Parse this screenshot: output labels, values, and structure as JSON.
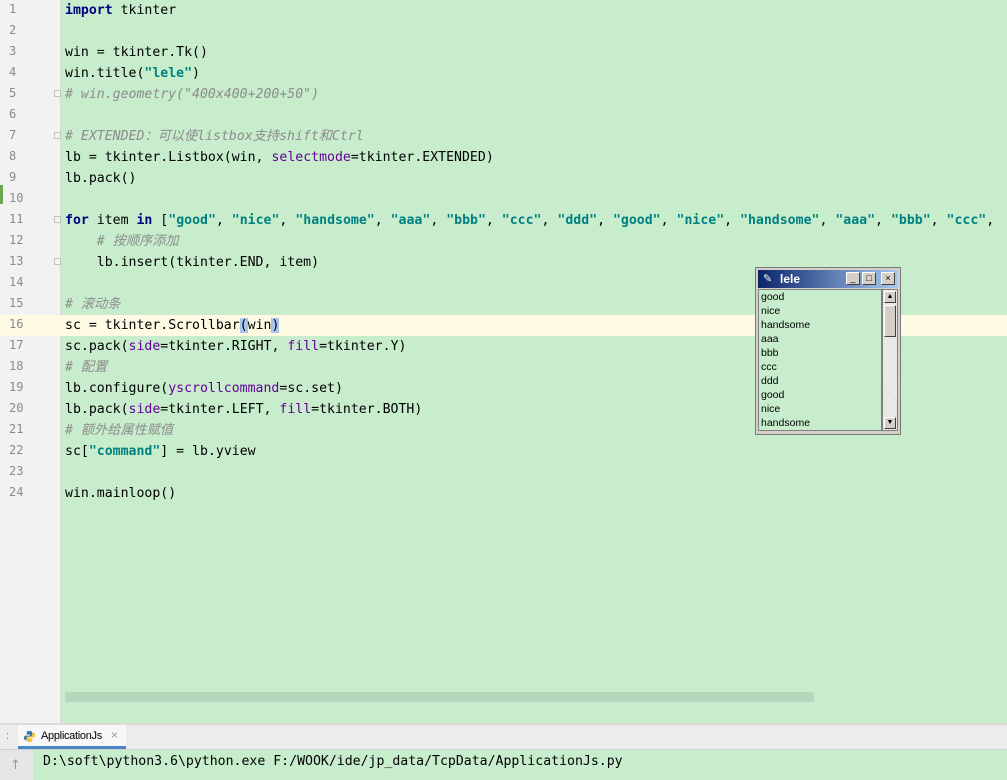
{
  "editor": {
    "line_numbers": [
      "1",
      "2",
      "3",
      "4",
      "5",
      "6",
      "7",
      "8",
      "9",
      "10",
      "11",
      "12",
      "13",
      "14",
      "15",
      "16",
      "17",
      "18",
      "19",
      "20",
      "21",
      "22",
      "23",
      "24"
    ],
    "current_line": "16"
  },
  "tk_window": {
    "title": "lele",
    "minimize_glyph": "_",
    "maximize_glyph": "□",
    "close_glyph": "×",
    "items": [
      "good",
      "nice",
      "handsome",
      "aaa",
      "bbb",
      "ccc",
      "ddd",
      "good",
      "nice",
      "handsome"
    ]
  },
  "run_panel": {
    "tab_label": "ApplicationJs",
    "tab_close": "×",
    "command": "D:\\soft\\python3.6\\python.exe F:/WOOK/ide/jp_data/TcpData/ApplicationJs.py"
  },
  "icons": {
    "python": "python-icon",
    "feather": "tk-feather-icon",
    "scroll_up": "scroll-up-arrow-icon"
  },
  "colors": {
    "editor_bg": "#C7EDCC",
    "current_line_bg": "#FFFAE3",
    "keyword": "#000080",
    "string": "#008080",
    "comment": "#8C8C8C",
    "param": "#660099",
    "titlebar_start": "#0A246A",
    "titlebar_end": "#A6CAF0"
  }
}
